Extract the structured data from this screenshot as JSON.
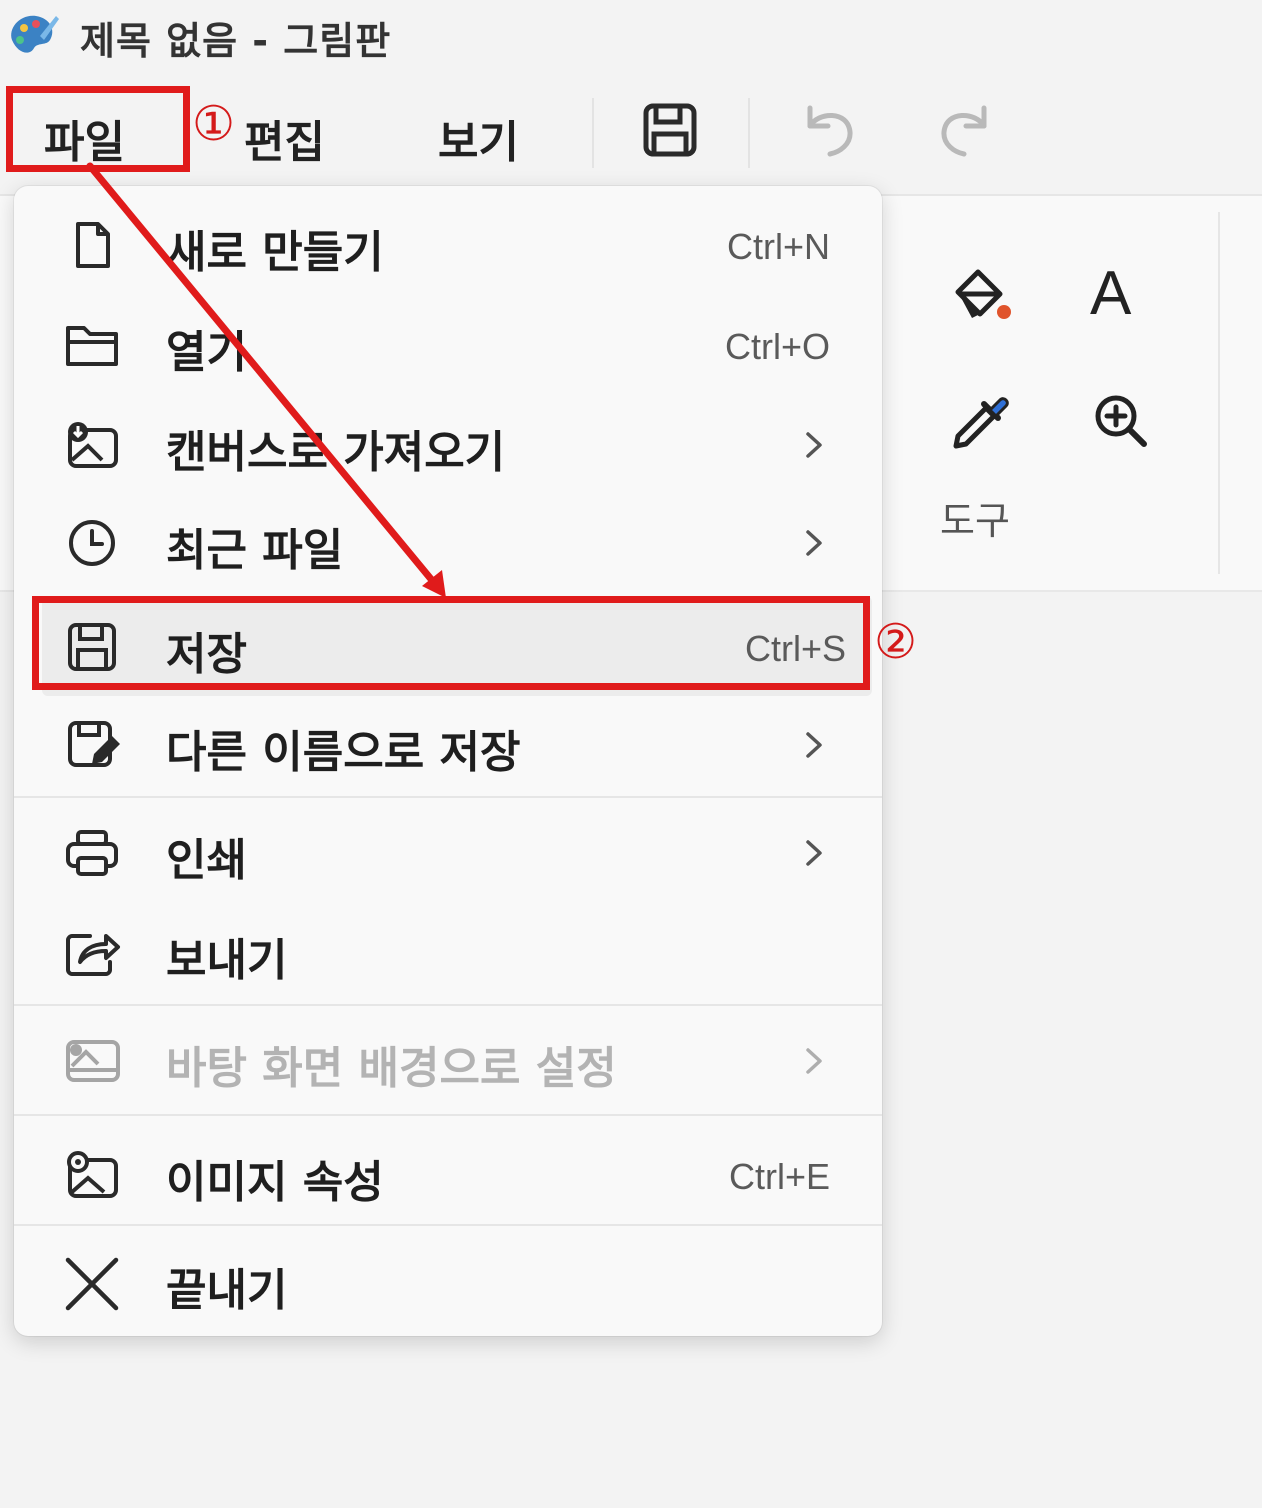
{
  "window": {
    "title": "제목 없음 - 그림판"
  },
  "menubar": {
    "items": [
      {
        "label": "파일"
      },
      {
        "label": "편집"
      },
      {
        "label": "보기"
      }
    ],
    "toolbar_icons": [
      "save-icon",
      "undo-icon",
      "redo-icon"
    ]
  },
  "ribbon": {
    "tools_label": "도구",
    "text_glyph": "A",
    "tool_icons": [
      "fill-bucket-icon",
      "text-icon",
      "color-picker-icon",
      "magnifier-icon"
    ]
  },
  "file_menu": {
    "items": [
      {
        "label": "새로 만들기",
        "shortcut": "Ctrl+N",
        "icon": "new-file-icon"
      },
      {
        "label": "열기",
        "shortcut": "Ctrl+O",
        "icon": "folder-open-icon"
      },
      {
        "label": "캔버스로 가져오기",
        "submenu": true,
        "icon": "import-image-icon"
      },
      {
        "label": "최근 파일",
        "submenu": true,
        "icon": "clock-icon"
      },
      {
        "label": "저장",
        "shortcut": "Ctrl+S",
        "icon": "save-icon",
        "highlighted": true
      },
      {
        "label": "다른 이름으로 저장",
        "submenu": true,
        "icon": "save-as-icon"
      },
      {
        "label": "인쇄",
        "submenu": true,
        "icon": "printer-icon"
      },
      {
        "label": "보내기",
        "icon": "share-icon"
      },
      {
        "label": "바탕 화면 배경으로 설정",
        "submenu": true,
        "disabled": true,
        "icon": "desktop-background-icon"
      },
      {
        "label": "이미지 속성",
        "shortcut": "Ctrl+E",
        "icon": "image-properties-icon"
      },
      {
        "label": "끝내기",
        "icon": "close-icon"
      }
    ]
  },
  "annotations": {
    "step1": "①",
    "step2": "②"
  },
  "colors": {
    "annotation_red": "#e01b1b",
    "menu_background": "#f9f9f9",
    "hover_background": "#ececec",
    "disabled_text": "#b3b3b3"
  }
}
